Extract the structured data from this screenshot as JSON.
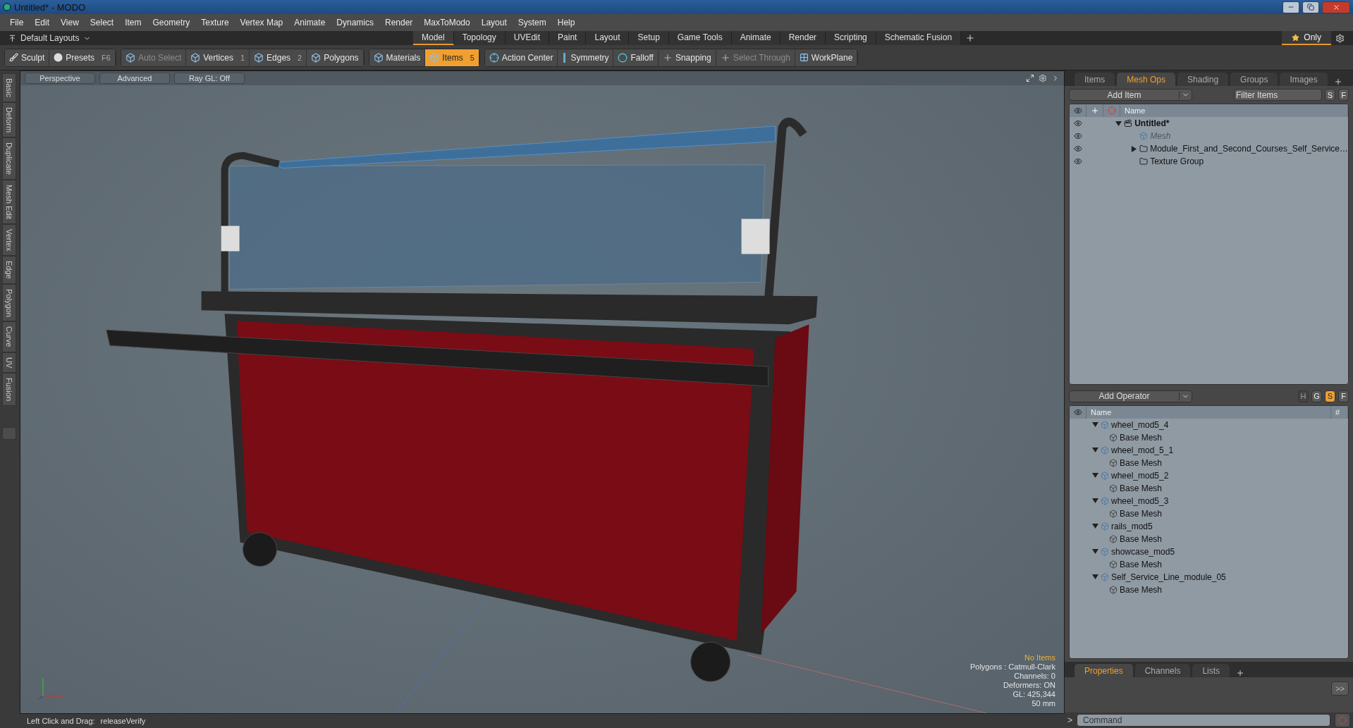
{
  "window": {
    "title": "Untitled* - MODO"
  },
  "menu": [
    "File",
    "Edit",
    "View",
    "Select",
    "Item",
    "Geometry",
    "Texture",
    "Vertex Map",
    "Animate",
    "Dynamics",
    "Render",
    "MaxToModo",
    "Layout",
    "System",
    "Help"
  ],
  "layouts": {
    "label": "Default Layouts",
    "only": "Only",
    "tabs": [
      {
        "label": "Model",
        "selected": true
      },
      {
        "label": "Topology",
        "selected": false
      },
      {
        "label": "UVEdit",
        "selected": false
      },
      {
        "label": "Paint",
        "selected": false
      },
      {
        "label": "Layout",
        "selected": false
      },
      {
        "label": "Setup",
        "selected": false
      },
      {
        "label": "Game Tools",
        "selected": false
      },
      {
        "label": "Animate",
        "selected": false
      },
      {
        "label": "Render",
        "selected": false
      },
      {
        "label": "Scripting",
        "selected": false
      },
      {
        "label": "Schematic Fusion",
        "selected": false
      }
    ]
  },
  "toolbar": [
    [
      {
        "label": "Sculpt",
        "kind": "brush",
        "selected": false,
        "disabled": false
      },
      {
        "label": "Presets",
        "shortcut": "F6",
        "kind": "preset",
        "selected": false,
        "disabled": false
      }
    ],
    [
      {
        "label": "Auto Select",
        "kind": "cube",
        "selected": false,
        "disabled": true
      },
      {
        "label": "Vertices",
        "shortcut": "1",
        "kind": "cube",
        "selected": false,
        "disabled": false
      },
      {
        "label": "Edges",
        "shortcut": "2",
        "kind": "cube",
        "selected": false,
        "disabled": false
      },
      {
        "label": "Polygons",
        "kind": "cube",
        "selected": false,
        "disabled": false
      }
    ],
    [
      {
        "label": "Materials",
        "kind": "cube",
        "selected": false,
        "disabled": false
      },
      {
        "label": "Items",
        "shortcut": "5",
        "kind": "cube",
        "selected": true,
        "disabled": false
      }
    ],
    [
      {
        "label": "Action Center",
        "kind": "target",
        "selected": false,
        "disabled": false
      },
      {
        "label": "Symmetry",
        "kind": "bar",
        "selected": false,
        "disabled": false
      },
      {
        "label": "Falloff",
        "kind": "ring",
        "selected": false,
        "disabled": false
      },
      {
        "label": "Snapping",
        "kind": "cross",
        "selected": false,
        "disabled": false
      },
      {
        "label": "Select Through",
        "kind": "cross",
        "selected": false,
        "disabled": true
      },
      {
        "label": "WorkPlane",
        "kind": "grid",
        "selected": false,
        "disabled": false
      }
    ]
  ],
  "side_tabs": [
    "Basic",
    "Deform",
    "Duplicate",
    "Mesh Edit",
    "Vertex",
    "Edge",
    "Polygon",
    "Curve",
    "UV",
    "Fusion"
  ],
  "viewport": {
    "header": [
      "Perspective",
      "Advanced",
      "Ray GL: Off"
    ],
    "info_title": "No Items",
    "info": [
      "Polygons : Catmull-Clark",
      "Channels: 0",
      "Deformers: ON",
      "GL: 425,344",
      "50 mm"
    ]
  },
  "status_bar": {
    "label": "Left Click and Drag:",
    "value": "releaseVerify"
  },
  "items_panel": {
    "tabs": [
      {
        "label": "Items",
        "selected": false
      },
      {
        "label": "Mesh Ops",
        "selected": true
      },
      {
        "label": "Shading",
        "selected": false
      },
      {
        "label": "Groups",
        "selected": false
      },
      {
        "label": "Images",
        "selected": false
      }
    ],
    "add_item": "Add Item",
    "filter": {
      "placeholder": "Filter Items"
    },
    "filter_buttons": [
      "S",
      "F"
    ],
    "column": "Name",
    "tree": [
      {
        "name": "Untitled*",
        "kind": "scene",
        "expanded": true,
        "children": [
          {
            "name": "Mesh",
            "kind": "mesh",
            "disabled": true
          },
          {
            "name": "Module_First_and_Second_Courses_Self_Service…",
            "kind": "group",
            "expanded": false,
            "disabled": false
          },
          {
            "name": "Texture Group",
            "kind": "group",
            "disabled": false
          }
        ]
      }
    ]
  },
  "meshops_panel": {
    "add": "Add Operator",
    "buttons": [
      {
        "label": "H",
        "selected": false,
        "disabled": true
      },
      {
        "label": "G",
        "selected": false,
        "disabled": false
      },
      {
        "label": "S",
        "selected": true,
        "disabled": false
      },
      {
        "label": "F",
        "selected": false,
        "disabled": false
      }
    ],
    "columns": [
      "Name",
      "#"
    ],
    "tree": [
      {
        "name": "wheel_mod5_4",
        "expanded": true,
        "children": [
          {
            "name": "Base Mesh"
          }
        ]
      },
      {
        "name": "wheel_mod_5_1",
        "expanded": true,
        "children": [
          {
            "name": "Base Mesh"
          }
        ]
      },
      {
        "name": "wheel_mod5_2",
        "expanded": true,
        "children": [
          {
            "name": "Base Mesh"
          }
        ]
      },
      {
        "name": "wheel_mod5_3",
        "expanded": true,
        "children": [
          {
            "name": "Base Mesh"
          }
        ]
      },
      {
        "name": "rails_mod5",
        "expanded": true,
        "children": [
          {
            "name": "Base Mesh"
          }
        ]
      },
      {
        "name": "showcase_mod5",
        "expanded": true,
        "children": [
          {
            "name": "Base Mesh"
          }
        ]
      },
      {
        "name": "Self_Service_Line_module_05",
        "expanded": true,
        "children": [
          {
            "name": "Base Mesh"
          }
        ]
      }
    ]
  },
  "properties_panel": {
    "tabs": [
      {
        "label": "Properties",
        "selected": true
      },
      {
        "label": "Channels",
        "selected": false
      },
      {
        "label": "Lists",
        "selected": false
      }
    ],
    "expand": ">>"
  },
  "command": {
    "prompt": ">",
    "placeholder": "Command"
  }
}
